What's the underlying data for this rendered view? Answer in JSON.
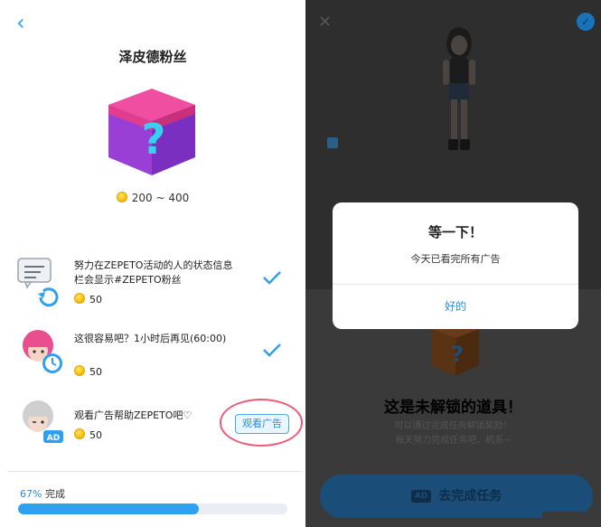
{
  "left": {
    "title": "泽皮德粉丝",
    "reward_range": "200 ~ 400",
    "tasks": [
      {
        "text": "努力在ZEPETO活动的人的状态信息栏会显示#ZEPETO粉丝",
        "points": "50",
        "status": "done"
      },
      {
        "text": "这很容易吧？1小时后再见(60:00)",
        "points": "50",
        "status": "done"
      },
      {
        "text": "观看广告帮助ZEPETO吧♡",
        "points": "50",
        "button_label": "观看广告"
      }
    ],
    "progress": {
      "percent_label": "67%",
      "label": "完成",
      "value": 0.67
    }
  },
  "dialog": {
    "title": "等一下！",
    "message": "今天已看完所有广告",
    "ok_label": "好的"
  },
  "background": {
    "locked_title": "这是未解锁的道具！",
    "locked_sub_1": "可以通过完成任务解锁奖励！",
    "locked_sub_2": "每天努力完成任务吧，机系~",
    "ad_tag": "AD",
    "button_label": "去完成任务"
  },
  "colors": {
    "accent": "#2f9ff0",
    "highlight_circle": "#f05a78",
    "overlay": "#2c2c2c"
  }
}
